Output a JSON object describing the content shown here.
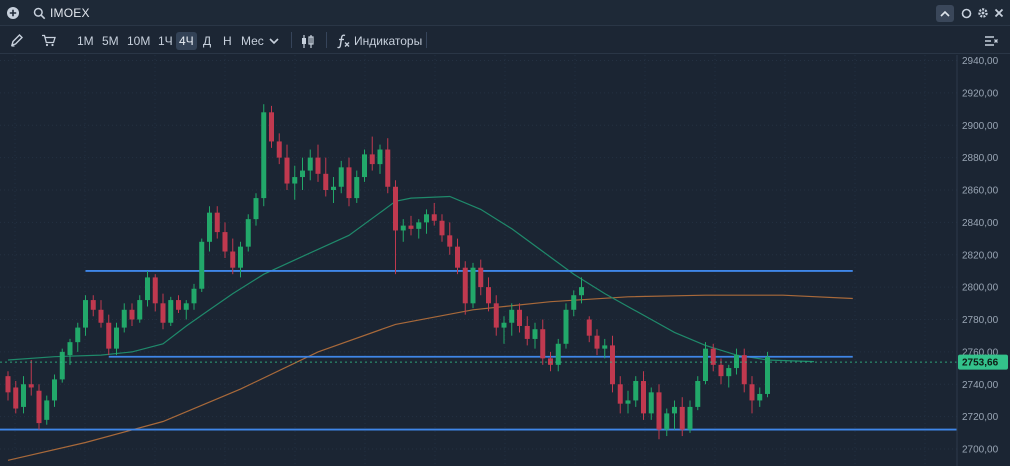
{
  "header": {
    "ticker": "IMOEX"
  },
  "toolbar": {
    "timeframes": [
      "1M",
      "5M",
      "10M",
      "1Ч",
      "4Ч",
      "Д",
      "Н",
      "Мес"
    ],
    "active_timeframe": "4Ч",
    "indicators_label": "Индикаторы"
  },
  "icons": {
    "top_left": [
      "add-icon",
      "search-icon"
    ],
    "top_right": [
      "chevron-up-icon",
      "circle-icon",
      "gear-icon",
      "close-icon"
    ],
    "toolbar": [
      "pencil-icon",
      "cart-icon",
      "chevron-down-icon",
      "candles-icon",
      "function-icon",
      "settings-list-icon"
    ]
  },
  "colors": {
    "background": "#1b2533",
    "candle_up": "#22a86a",
    "candle_down": "#c0394f",
    "level_line": "#3f86e8",
    "ma_fast": "#1f8a6b",
    "ma_slow": "#a8693a",
    "price_tag": "#33c28b"
  },
  "chart_data": {
    "type": "candlestick",
    "title": "",
    "y_ticks": [
      "2940,00",
      "2920,00",
      "2900,00",
      "2880,00",
      "2860,00",
      "2840,00",
      "2820,00",
      "2800,00",
      "2780,00",
      "2760,00",
      "2740,00",
      "2720,00",
      "2700,00"
    ],
    "ylim": [
      2695,
      2943
    ],
    "current_price": 2753.66,
    "current_price_label": "2753,66",
    "levels": [
      {
        "price": 2810,
        "from_index": 10,
        "to_index": 109
      },
      {
        "price": 2757,
        "from_index": 13,
        "to_index": 109
      },
      {
        "price": 2712,
        "from_index": 0,
        "to_index": 131
      }
    ],
    "candles": [
      [
        2745,
        2748,
        2730,
        2735
      ],
      [
        2738,
        2742,
        2722,
        2725
      ],
      [
        2726,
        2745,
        2722,
        2740
      ],
      [
        2740,
        2755,
        2733,
        2738
      ],
      [
        2736,
        2740,
        2712,
        2716
      ],
      [
        2718,
        2733,
        2715,
        2730
      ],
      [
        2730,
        2746,
        2726,
        2743
      ],
      [
        2743,
        2762,
        2741,
        2760
      ],
      [
        2758,
        2768,
        2752,
        2766
      ],
      [
        2766,
        2778,
        2760,
        2775
      ],
      [
        2775,
        2795,
        2770,
        2792
      ],
      [
        2792,
        2795,
        2782,
        2786
      ],
      [
        2786,
        2792,
        2775,
        2778
      ],
      [
        2778,
        2783,
        2758,
        2762
      ],
      [
        2762,
        2778,
        2758,
        2775
      ],
      [
        2775,
        2790,
        2772,
        2786
      ],
      [
        2786,
        2790,
        2776,
        2780
      ],
      [
        2780,
        2795,
        2778,
        2792
      ],
      [
        2792,
        2810,
        2788,
        2806
      ],
      [
        2806,
        2808,
        2785,
        2790
      ],
      [
        2790,
        2796,
        2774,
        2778
      ],
      [
        2778,
        2794,
        2776,
        2792
      ],
      [
        2792,
        2795,
        2784,
        2786
      ],
      [
        2786,
        2792,
        2780,
        2790
      ],
      [
        2790,
        2802,
        2786,
        2799
      ],
      [
        2799,
        2830,
        2797,
        2828
      ],
      [
        2828,
        2850,
        2822,
        2846
      ],
      [
        2846,
        2850,
        2830,
        2834
      ],
      [
        2834,
        2840,
        2818,
        2822
      ],
      [
        2822,
        2830,
        2808,
        2812
      ],
      [
        2812,
        2828,
        2806,
        2825
      ],
      [
        2825,
        2845,
        2822,
        2842
      ],
      [
        2842,
        2858,
        2838,
        2855
      ],
      [
        2855,
        2913,
        2850,
        2908
      ],
      [
        2908,
        2912,
        2886,
        2890
      ],
      [
        2890,
        2895,
        2876,
        2880
      ],
      [
        2880,
        2888,
        2860,
        2864
      ],
      [
        2864,
        2875,
        2854,
        2868
      ],
      [
        2868,
        2880,
        2860,
        2872
      ],
      [
        2872,
        2885,
        2866,
        2880
      ],
      [
        2880,
        2888,
        2865,
        2870
      ],
      [
        2870,
        2880,
        2856,
        2860
      ],
      [
        2860,
        2868,
        2852,
        2862
      ],
      [
        2862,
        2878,
        2858,
        2874
      ],
      [
        2874,
        2880,
        2850,
        2855
      ],
      [
        2855,
        2872,
        2852,
        2868
      ],
      [
        2868,
        2885,
        2865,
        2882
      ],
      [
        2882,
        2893,
        2872,
        2876
      ],
      [
        2876,
        2888,
        2870,
        2885
      ],
      [
        2885,
        2892,
        2858,
        2862
      ],
      [
        2862,
        2866,
        2808,
        2835
      ],
      [
        2835,
        2842,
        2828,
        2838
      ],
      [
        2838,
        2844,
        2832,
        2836
      ],
      [
        2836,
        2842,
        2830,
        2840
      ],
      [
        2840,
        2848,
        2833,
        2845
      ],
      [
        2845,
        2852,
        2838,
        2841
      ],
      [
        2841,
        2845,
        2828,
        2832
      ],
      [
        2832,
        2840,
        2820,
        2825
      ],
      [
        2825,
        2830,
        2808,
        2812
      ],
      [
        2812,
        2816,
        2783,
        2790
      ],
      [
        2790,
        2815,
        2787,
        2812
      ],
      [
        2812,
        2817,
        2795,
        2800
      ],
      [
        2800,
        2806,
        2785,
        2790
      ],
      [
        2790,
        2795,
        2770,
        2775
      ],
      [
        2775,
        2782,
        2765,
        2778
      ],
      [
        2778,
        2790,
        2770,
        2786
      ],
      [
        2786,
        2790,
        2772,
        2776
      ],
      [
        2776,
        2782,
        2764,
        2768
      ],
      [
        2768,
        2778,
        2762,
        2774
      ],
      [
        2774,
        2780,
        2752,
        2756
      ],
      [
        2756,
        2760,
        2748,
        2752
      ],
      [
        2752,
        2768,
        2748,
        2765
      ],
      [
        2765,
        2790,
        2762,
        2786
      ],
      [
        2786,
        2798,
        2782,
        2795
      ],
      [
        2795,
        2806,
        2790,
        2800
      ],
      [
        2780,
        2782,
        2766,
        2770
      ],
      [
        2770,
        2774,
        2758,
        2762
      ],
      [
        2762,
        2768,
        2756,
        2764
      ],
      [
        2764,
        2770,
        2735,
        2740
      ],
      [
        2740,
        2745,
        2722,
        2728
      ],
      [
        2728,
        2736,
        2722,
        2730
      ],
      [
        2730,
        2745,
        2726,
        2742
      ],
      [
        2742,
        2748,
        2718,
        2722
      ],
      [
        2722,
        2738,
        2718,
        2735
      ],
      [
        2735,
        2740,
        2706,
        2712
      ],
      [
        2712,
        2725,
        2708,
        2722
      ],
      [
        2722,
        2730,
        2712,
        2726
      ],
      [
        2726,
        2732,
        2708,
        2712
      ],
      [
        2712,
        2730,
        2710,
        2726
      ],
      [
        2726,
        2745,
        2724,
        2742
      ],
      [
        2742,
        2766,
        2740,
        2762
      ],
      [
        2762,
        2765,
        2748,
        2752
      ],
      [
        2752,
        2756,
        2740,
        2745
      ],
      [
        2745,
        2752,
        2738,
        2750
      ],
      [
        2750,
        2762,
        2746,
        2758
      ],
      [
        2758,
        2762,
        2735,
        2740
      ],
      [
        2740,
        2745,
        2722,
        2730
      ],
      [
        2730,
        2738,
        2726,
        2734
      ],
      [
        2734,
        2760,
        2732,
        2757
      ]
    ],
    "ma_fast": [
      [
        0,
        2755
      ],
      [
        6,
        2757
      ],
      [
        12,
        2758
      ],
      [
        16,
        2760
      ],
      [
        20,
        2765
      ],
      [
        23,
        2776
      ],
      [
        26,
        2786
      ],
      [
        29,
        2796
      ],
      [
        33,
        2808
      ],
      [
        38,
        2819
      ],
      [
        44,
        2832
      ],
      [
        48,
        2846
      ],
      [
        50,
        2853
      ],
      [
        52,
        2855
      ],
      [
        57,
        2856
      ],
      [
        61,
        2848
      ],
      [
        65,
        2836
      ],
      [
        69,
        2822
      ],
      [
        73,
        2808
      ],
      [
        77,
        2796
      ],
      [
        80,
        2788
      ],
      [
        83,
        2780
      ],
      [
        86,
        2772
      ],
      [
        90,
        2764
      ],
      [
        94,
        2758
      ],
      [
        98,
        2755
      ],
      [
        104,
        2754
      ]
    ],
    "ma_slow": [
      [
        0,
        2693
      ],
      [
        10,
        2704
      ],
      [
        20,
        2717
      ],
      [
        30,
        2737
      ],
      [
        40,
        2760
      ],
      [
        50,
        2777
      ],
      [
        60,
        2786
      ],
      [
        70,
        2791
      ],
      [
        80,
        2794
      ],
      [
        90,
        2795
      ],
      [
        100,
        2795
      ],
      [
        109,
        2793
      ]
    ]
  }
}
